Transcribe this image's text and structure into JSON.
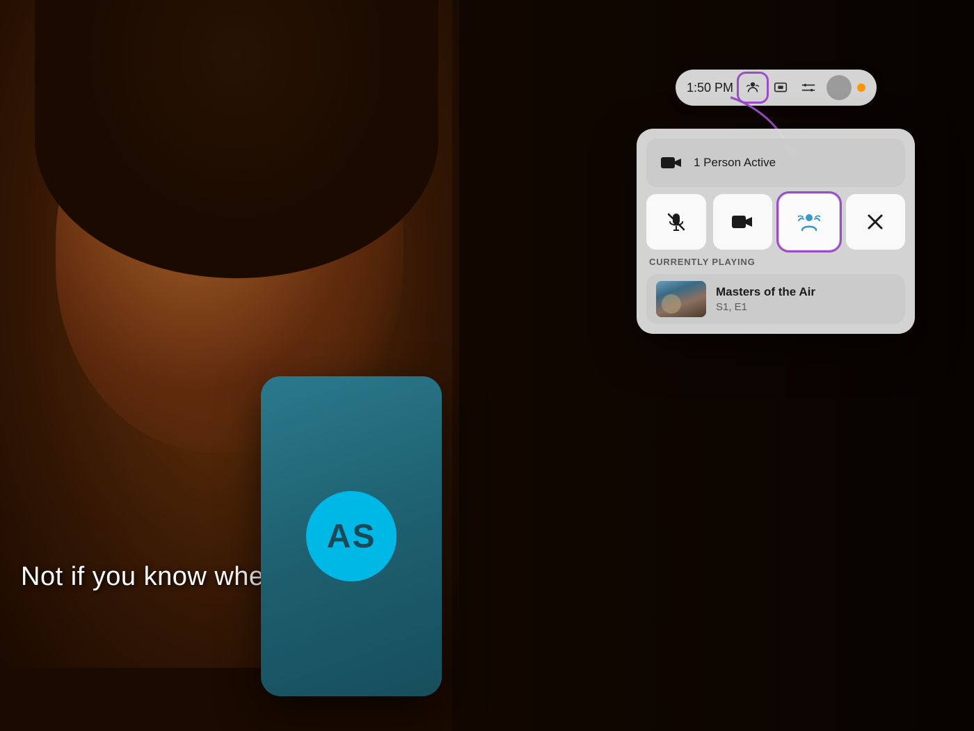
{
  "background": {
    "subtitle": "Not if you know wher"
  },
  "avatar": {
    "initials": "AS"
  },
  "menu_bar": {
    "time": "1:50 PM"
  },
  "popup": {
    "video_row": {
      "label": "1 Person Active"
    },
    "buttons": [
      {
        "id": "mic",
        "label": "Mute",
        "active": false
      },
      {
        "id": "camera",
        "label": "Camera",
        "active": false
      },
      {
        "id": "shareplay",
        "label": "SharePlay",
        "active": true
      },
      {
        "id": "close",
        "label": "Close",
        "active": false
      }
    ],
    "currently_playing_label": "CURRENTLY PLAYING",
    "now_playing": {
      "title": "Masters of the Air",
      "subtitle": "S1, E1"
    }
  }
}
